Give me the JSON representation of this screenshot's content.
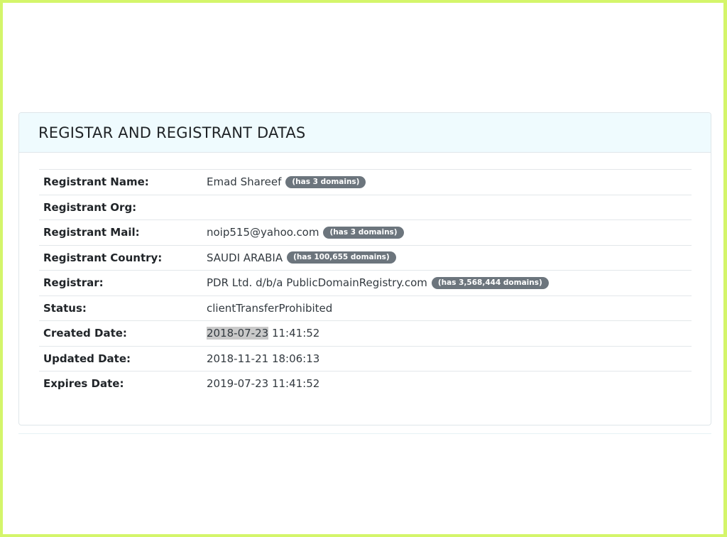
{
  "panel": {
    "title": "REGISTAR AND REGISTRANT DATAS"
  },
  "rows": [
    {
      "label": "Registrant Name:",
      "value": "Emad Shareef",
      "badge": "(has 3 domains)"
    },
    {
      "label": "Registrant Org:",
      "value": ""
    },
    {
      "label": "Registrant Mail:",
      "value": "noip515@yahoo.com",
      "badge": "(has 3 domains)"
    },
    {
      "label": "Registrant Country:",
      "value": "SAUDI ARABIA",
      "badge": "(has 100,655 domains)"
    },
    {
      "label": "Registrar:",
      "value": "PDR Ltd. d/b/a PublicDomainRegistry.com",
      "badge": "(has 3,568,444 domains)"
    },
    {
      "label": "Status:",
      "value": "clientTransferProhibited"
    },
    {
      "label": "Created Date:",
      "value_date": "2018-07-23",
      "value_time": "11:41:52"
    },
    {
      "label": "Updated Date:",
      "value": "2018-11-21 18:06:13"
    },
    {
      "label": "Expires Date:",
      "value": "2019-07-23 11:41:52"
    }
  ],
  "colors": {
    "frame_border": "#d4f56a",
    "header_bg": "#effbfe",
    "badge_bg": "#6c757d",
    "selection_highlight": "#c9c9c9"
  }
}
